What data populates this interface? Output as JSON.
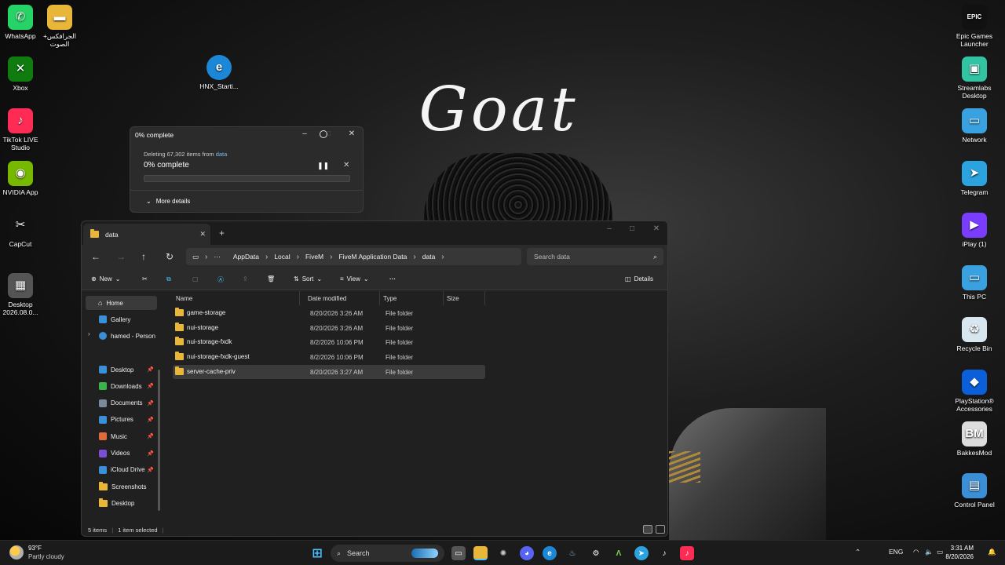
{
  "wallpaper": {
    "title": "Goat"
  },
  "desktop_left": [
    {
      "label": "WhatsApp",
      "glyph": "✆",
      "color": "#25d366"
    },
    {
      "label": "الجرافكس+ الصوت",
      "glyph": "▬",
      "color": "#e8b739"
    },
    {
      "label": "Xbox",
      "glyph": "✕",
      "color": "#107c10"
    },
    {
      "label": "TikTok LIVE Studio",
      "glyph": "♪",
      "color": "#fe2c55"
    },
    {
      "label": "NVIDIA App",
      "glyph": "◉",
      "color": "#76b900"
    },
    {
      "label": "CapCut",
      "glyph": "✂",
      "color": "#111111"
    },
    {
      "label": "Desktop 2026.08.0...",
      "glyph": "▦",
      "color": "#555555"
    }
  ],
  "desktop_mid": {
    "label": "HNX_Starti...",
    "glyph": "e",
    "color": "#1b87d6"
  },
  "desktop_right": [
    {
      "label": "Epic Games Launcher",
      "glyph": "EPIC",
      "color": "#111111"
    },
    {
      "label": "Streamlabs Desktop",
      "glyph": "▣",
      "color": "#31c3a2"
    },
    {
      "label": "Network",
      "glyph": "▭",
      "color": "#3aa1e0"
    },
    {
      "label": "Telegram",
      "glyph": "➤",
      "color": "#2aa3df"
    },
    {
      "label": "iPlay (1)",
      "glyph": "▶",
      "color": "#7a3cff"
    },
    {
      "label": "This PC",
      "glyph": "▭",
      "color": "#3aa1e0"
    },
    {
      "label": "Recycle Bin",
      "glyph": "♻",
      "color": "#d8e6ef"
    },
    {
      "label": "PlayStation® Accessories",
      "glyph": "◆",
      "color": "#0b5fd8"
    },
    {
      "label": "BakkesMod",
      "glyph": "BM",
      "color": "#dddddd"
    },
    {
      "label": "Control Panel",
      "glyph": "▤",
      "color": "#3a8fd6"
    }
  ],
  "progress_dialog": {
    "title": "0% complete",
    "desc_prefix": "Deleting 67,302 items from ",
    "desc_link": "data",
    "status": "0% complete",
    "progress_fraction": 0,
    "more_details": "More details"
  },
  "explorer": {
    "tab_title": "data",
    "breadcrumbs": [
      "AppData",
      "Local",
      "FiveM",
      "FiveM Application Data",
      "data"
    ],
    "ellipsis": "···",
    "search_placeholder": "Search data",
    "toolbar": {
      "new": "New",
      "sort": "Sort",
      "view": "View",
      "more": "···",
      "details": "Details"
    },
    "nav": {
      "home": "Home",
      "gallery": "Gallery",
      "onedrive": "hamed - Person",
      "quick": [
        {
          "label": "Desktop",
          "pinned": true
        },
        {
          "label": "Downloads",
          "pinned": true
        },
        {
          "label": "Documents",
          "pinned": true
        },
        {
          "label": "Pictures",
          "pinned": true
        },
        {
          "label": "Music",
          "pinned": true
        },
        {
          "label": "Videos",
          "pinned": true
        },
        {
          "label": "iCloud Drive",
          "pinned": true
        },
        {
          "label": "Screenshots",
          "pinned": false
        },
        {
          "label": "Desktop",
          "pinned": false
        }
      ],
      "pin_glyph": "📌"
    },
    "columns": [
      "Name",
      "Date modified",
      "Type",
      "Size"
    ],
    "rows": [
      {
        "name": "game-storage",
        "date": "8/20/2026 3:26 AM",
        "type": "File folder",
        "selected": false
      },
      {
        "name": "nui-storage",
        "date": "8/20/2026 3:26 AM",
        "type": "File folder",
        "selected": false
      },
      {
        "name": "nui-storage-fxdk",
        "date": "8/2/2026 10:06 PM",
        "type": "File folder",
        "selected": false
      },
      {
        "name": "nui-storage-fxdk-guest",
        "date": "8/2/2026 10:06 PM",
        "type": "File folder",
        "selected": false
      },
      {
        "name": "server-cache-priv",
        "date": "8/20/2026 3:27 AM",
        "type": "File folder",
        "selected": true
      }
    ],
    "status": {
      "items": "5 items",
      "selected": "1 item selected"
    }
  },
  "taskbar": {
    "weather_temp": "93°F",
    "weather_desc": "Partly cloudy",
    "search_label": "Search",
    "lang": "ENG",
    "time": "3:31 AM",
    "date": "8/20/2026"
  },
  "colors": {
    "accent": "#4cc2ff",
    "folder": "#e8b739"
  }
}
